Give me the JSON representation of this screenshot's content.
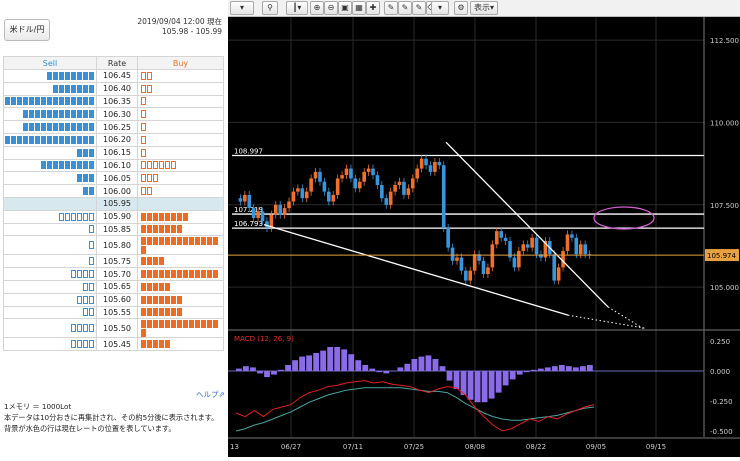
{
  "pair_label": "米ドル/円",
  "timestamp": "2019/09/04 12:00 現在",
  "quote": "105.98 - 105.99",
  "headers": {
    "sell": "Sell",
    "rate": "Rate",
    "buy": "Buy"
  },
  "book": [
    {
      "rate": "106.45",
      "sell": 8,
      "sell_style": "filled",
      "buy": 2,
      "buy_style": "outline"
    },
    {
      "rate": "106.40",
      "sell": 7,
      "sell_style": "filled",
      "buy": 2,
      "buy_style": "outline"
    },
    {
      "rate": "106.35",
      "sell": 15,
      "sell_style": "filled",
      "buy": 1,
      "buy_style": "outline"
    },
    {
      "rate": "106.30",
      "sell": 12,
      "sell_style": "filled",
      "buy": 1,
      "buy_style": "outline"
    },
    {
      "rate": "106.25",
      "sell": 12,
      "sell_style": "filled",
      "buy": 1,
      "buy_style": "outline"
    },
    {
      "rate": "106.20",
      "sell": 15,
      "sell_style": "filled",
      "buy": 1,
      "buy_style": "outline"
    },
    {
      "rate": "106.15",
      "sell": 3,
      "sell_style": "filled",
      "buy": 1,
      "buy_style": "outline"
    },
    {
      "rate": "106.10",
      "sell": 9,
      "sell_style": "filled",
      "buy": 6,
      "buy_style": "outline"
    },
    {
      "rate": "106.05",
      "sell": 3,
      "sell_style": "filled",
      "buy": 3,
      "buy_style": "outline"
    },
    {
      "rate": "106.00",
      "sell": 2,
      "sell_style": "filled",
      "buy": 2,
      "buy_style": "outline"
    },
    {
      "rate": "105.95",
      "sell": 0,
      "sell_style": "filled",
      "buy": 0,
      "buy_style": "filled",
      "current": true
    },
    {
      "rate": "105.90",
      "sell": 6,
      "sell_style": "outline",
      "buy": 8,
      "buy_style": "filled"
    },
    {
      "rate": "105.85",
      "sell": 1,
      "sell_style": "outline",
      "buy": 7,
      "buy_style": "filled"
    },
    {
      "rate": "105.80",
      "sell": 1,
      "sell_style": "outline",
      "buy": 14,
      "buy_style": "filled"
    },
    {
      "rate": "105.75",
      "sell": 1,
      "sell_style": "outline",
      "buy": 4,
      "buy_style": "filled"
    },
    {
      "rate": "105.70",
      "sell": 4,
      "sell_style": "outline",
      "buy": 13,
      "buy_style": "filled"
    },
    {
      "rate": "105.65",
      "sell": 2,
      "sell_style": "outline",
      "buy": 5,
      "buy_style": "filled"
    },
    {
      "rate": "105.60",
      "sell": 3,
      "sell_style": "outline",
      "buy": 7,
      "buy_style": "filled"
    },
    {
      "rate": "105.55",
      "sell": 2,
      "sell_style": "outline",
      "buy": 7,
      "buy_style": "filled"
    },
    {
      "rate": "105.50",
      "sell": 4,
      "sell_style": "outline",
      "buy": 14,
      "buy_style": "filled"
    },
    {
      "rate": "105.45",
      "sell": 4,
      "sell_style": "outline",
      "buy": 5,
      "buy_style": "filled"
    }
  ],
  "help_label": "ヘルプ",
  "notes": [
    "1メモリ ＝ 1000Lot",
    "本データは10分おきに再集計され、その約5分後に表示されます。",
    "背景が水色の行は現在レートの位置を表しています。"
  ],
  "toolbar": {
    "display_label": "表示"
  },
  "chart_data": {
    "type": "candlestick",
    "price_axis_ticks": [
      "112.500",
      "110.000",
      "107.500",
      "105.000"
    ],
    "date_axis_ticks": [
      "06/27",
      "07/11",
      "07/25",
      "08/08",
      "08/22",
      "09/05",
      "09/15"
    ],
    "current_price": "105.974",
    "level_labels": [
      "108.997",
      "107.219",
      "106.793"
    ],
    "macd_label": "MACD (12, 26, 9)",
    "macd_axis_ticks": [
      "0.250",
      "0.000",
      "-0.250",
      "-0.500"
    ],
    "colors": {
      "up": "#f0712b",
      "down": "#3a96dc",
      "histogram": "#8a6be8",
      "macd": "#e02020",
      "signal": "#4aa3a0",
      "current": "#e8a040",
      "ellipse": "#d060d0"
    }
  }
}
